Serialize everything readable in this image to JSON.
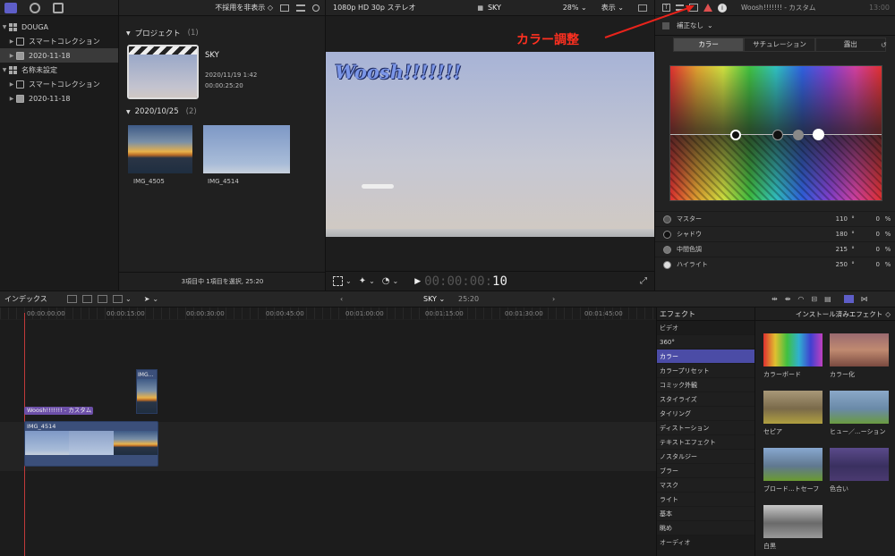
{
  "library": {
    "toolbar_filter": "不採用を非表示",
    "items": [
      {
        "label": "DOUGA",
        "level": 0
      },
      {
        "label": "スマートコレクション",
        "level": 1
      },
      {
        "label": "2020-11-18",
        "level": 1
      },
      {
        "label": "名称未設定",
        "level": 0
      },
      {
        "label": "スマートコレクション",
        "level": 1
      },
      {
        "label": "2020-11-18",
        "level": 1
      }
    ]
  },
  "browser": {
    "project_group": "プロジェクト",
    "project_count": "(1)",
    "project": {
      "name": "SKY",
      "date": "2020/11/19 1:42",
      "duration": "00:00:25:20"
    },
    "date_group": "2020/10/25",
    "date_count": "(2)",
    "clips": [
      {
        "name": "IMG_4505"
      },
      {
        "name": "IMG_4514"
      }
    ],
    "status": "3項目中 1項目を選択, 25:20"
  },
  "viewer": {
    "format": "1080p HD 30p ステレオ",
    "title": "SKY",
    "zoom": "28%",
    "view_label": "表示",
    "overlay_text": "Woosh!!!!!!!",
    "timecode_dim": "00:00:00:",
    "timecode_frames": "10"
  },
  "inspector": {
    "title": "Woosh!!!!!!! - カスタム",
    "time": "13:00",
    "correction": "補正なし",
    "annotation": "カラー調整",
    "tabs": [
      "カラー",
      "サチュレーション",
      "露出"
    ],
    "params": [
      {
        "label": "マスター",
        "angle": "110",
        "deg": "°",
        "pct": "0",
        "unit": "%"
      },
      {
        "label": "シャドウ",
        "angle": "180",
        "deg": "°",
        "pct": "0",
        "unit": "%"
      },
      {
        "label": "中間色調",
        "angle": "215",
        "deg": "°",
        "pct": "0",
        "unit": "%"
      },
      {
        "label": "ハイライト",
        "angle": "250",
        "deg": "°",
        "pct": "0",
        "unit": "%"
      }
    ]
  },
  "timeline": {
    "index_label": "インデックス",
    "project": "SKY",
    "duration": "25:20",
    "ruler": [
      "00:00:00:00",
      "00:00:15:00",
      "00:00:30:00",
      "00:00:45:00",
      "00:01:00:00",
      "00:01:15:00",
      "00:01:30:00",
      "00:01:45:00"
    ],
    "title_clip": "Woosh!!!!!!! - カスタム",
    "small_clip": "IMG...",
    "main_clip": "IMG_4514"
  },
  "effects": {
    "header": "エフェクト",
    "categories": [
      "ビデオ",
      "360°",
      "カラー",
      "カラープリセット",
      "コミック外観",
      "スタイライズ",
      "タイリング",
      "ディストーション",
      "テキストエフェクト",
      "ノスタルジー",
      "ブラー",
      "マスク",
      "ライト",
      "基本",
      "眺め",
      "オーディオ"
    ],
    "selected": "カラー",
    "installed_label": "インストール済みエフェクト",
    "tiles": [
      "カラーボード",
      "カラー化",
      "セピア",
      "ヒュー／...ーション",
      "ブロード...トセーフ",
      "色合い",
      "白黒"
    ]
  },
  "colors": {
    "accent": "#5e5ec8",
    "selection": "#4b4ca6",
    "title_clip": "#6c4fa8",
    "annotation": "#ff3020"
  }
}
